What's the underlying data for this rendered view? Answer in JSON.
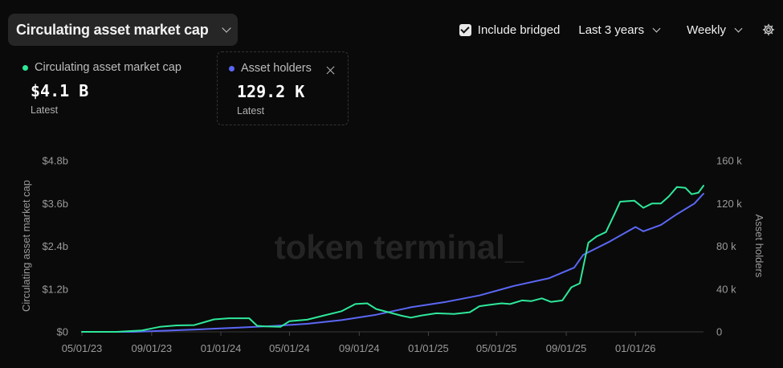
{
  "metric_selector": {
    "label": "Circulating asset market cap"
  },
  "controls": {
    "include_bridged_label": "Include bridged",
    "include_bridged_checked": true,
    "range_label": "Last 3 years",
    "interval_label": "Weekly",
    "settings_icon": "gear-icon"
  },
  "cards": [
    {
      "name": "Circulating asset market cap",
      "value": "$4.1 B",
      "sub": "Latest",
      "color": "#2ee89a"
    },
    {
      "name": "Asset holders",
      "value": "129.2 K",
      "sub": "Latest",
      "color": "#5b67f5"
    }
  ],
  "watermark": "token terminal_",
  "chart_data": {
    "type": "line",
    "x_axis": {
      "ticks": [
        "05/01/23",
        "09/01/23",
        "01/01/24",
        "05/01/24",
        "09/01/24",
        "01/01/25",
        "05/01/25",
        "09/01/25",
        "01/01/26"
      ]
    },
    "y_left": {
      "label": "Circulating asset market cap",
      "ticks": [
        "$0",
        "$1.2b",
        "$2.4b",
        "$3.6b",
        "$4.8b"
      ],
      "range": [
        0,
        4.8
      ],
      "unit": "b"
    },
    "y_right": {
      "label": "Asset holders",
      "ticks": [
        "0",
        "40 k",
        "80 k",
        "120 k",
        "160 k"
      ],
      "range": [
        0,
        160000
      ]
    },
    "grid": false,
    "series": [
      {
        "name": "Circulating asset market cap",
        "axis": "left",
        "color": "#2ee89a",
        "points": [
          [
            "05/01/23",
            0.0
          ],
          [
            "07/01/23",
            0.0
          ],
          [
            "08/15/23",
            0.04
          ],
          [
            "09/15/23",
            0.14
          ],
          [
            "10/15/23",
            0.18
          ],
          [
            "11/15/23",
            0.19
          ],
          [
            "12/20/23",
            0.35
          ],
          [
            "01/15/24",
            0.38
          ],
          [
            "02/20/24",
            0.38
          ],
          [
            "03/05/24",
            0.17
          ],
          [
            "03/20/24",
            0.15
          ],
          [
            "04/15/24",
            0.14
          ],
          [
            "05/01/24",
            0.3
          ],
          [
            "06/01/24",
            0.34
          ],
          [
            "07/01/24",
            0.46
          ],
          [
            "08/01/24",
            0.58
          ],
          [
            "08/25/24",
            0.78
          ],
          [
            "09/15/24",
            0.8
          ],
          [
            "10/01/24",
            0.64
          ],
          [
            "10/20/24",
            0.56
          ],
          [
            "11/15/24",
            0.45
          ],
          [
            "12/01/24",
            0.4
          ],
          [
            "12/20/24",
            0.46
          ],
          [
            "01/15/25",
            0.52
          ],
          [
            "02/15/25",
            0.5
          ],
          [
            "03/15/25",
            0.55
          ],
          [
            "04/01/25",
            0.72
          ],
          [
            "04/20/25",
            0.76
          ],
          [
            "05/10/25",
            0.8
          ],
          [
            "05/25/25",
            0.78
          ],
          [
            "06/15/25",
            0.88
          ],
          [
            "07/01/25",
            0.86
          ],
          [
            "07/20/25",
            0.94
          ],
          [
            "08/05/25",
            0.84
          ],
          [
            "08/25/25",
            0.88
          ],
          [
            "09/10/25",
            1.25
          ],
          [
            "09/25/25",
            1.36
          ],
          [
            "10/10/25",
            2.5
          ],
          [
            "10/25/25",
            2.68
          ],
          [
            "11/10/25",
            2.8
          ],
          [
            "11/25/25",
            3.3
          ],
          [
            "12/05/25",
            3.65
          ],
          [
            "12/30/25",
            3.68
          ],
          [
            "01/15/26",
            3.48
          ],
          [
            "01/30/26",
            3.6
          ],
          [
            "02/15/26",
            3.6
          ],
          [
            "03/01/26",
            3.8
          ],
          [
            "03/15/26",
            4.06
          ],
          [
            "03/30/26",
            4.04
          ],
          [
            "04/10/26",
            3.86
          ],
          [
            "04/22/26",
            3.9
          ],
          [
            "05/01/26",
            4.1
          ]
        ]
      },
      {
        "name": "Asset holders",
        "axis": "right",
        "color": "#5b67f5",
        "points": [
          [
            "05/01/23",
            0
          ],
          [
            "08/01/23",
            0
          ],
          [
            "10/01/23",
            1200
          ],
          [
            "12/01/23",
            2500
          ],
          [
            "02/01/24",
            4000
          ],
          [
            "04/01/24",
            5500
          ],
          [
            "06/01/24",
            7500
          ],
          [
            "08/01/24",
            11000
          ],
          [
            "10/01/24",
            16000
          ],
          [
            "12/01/24",
            23000
          ],
          [
            "02/01/25",
            28000
          ],
          [
            "04/01/25",
            34000
          ],
          [
            "06/01/25",
            43000
          ],
          [
            "08/01/25",
            50000
          ],
          [
            "09/15/25",
            60000
          ],
          [
            "10/01/25",
            72000
          ],
          [
            "11/15/25",
            84000
          ],
          [
            "12/15/25",
            93000
          ],
          [
            "01/01/26",
            98000
          ],
          [
            "01/15/26",
            94000
          ],
          [
            "02/15/26",
            100000
          ],
          [
            "03/15/26",
            110000
          ],
          [
            "04/15/26",
            120000
          ],
          [
            "05/01/26",
            129200
          ]
        ]
      }
    ]
  }
}
